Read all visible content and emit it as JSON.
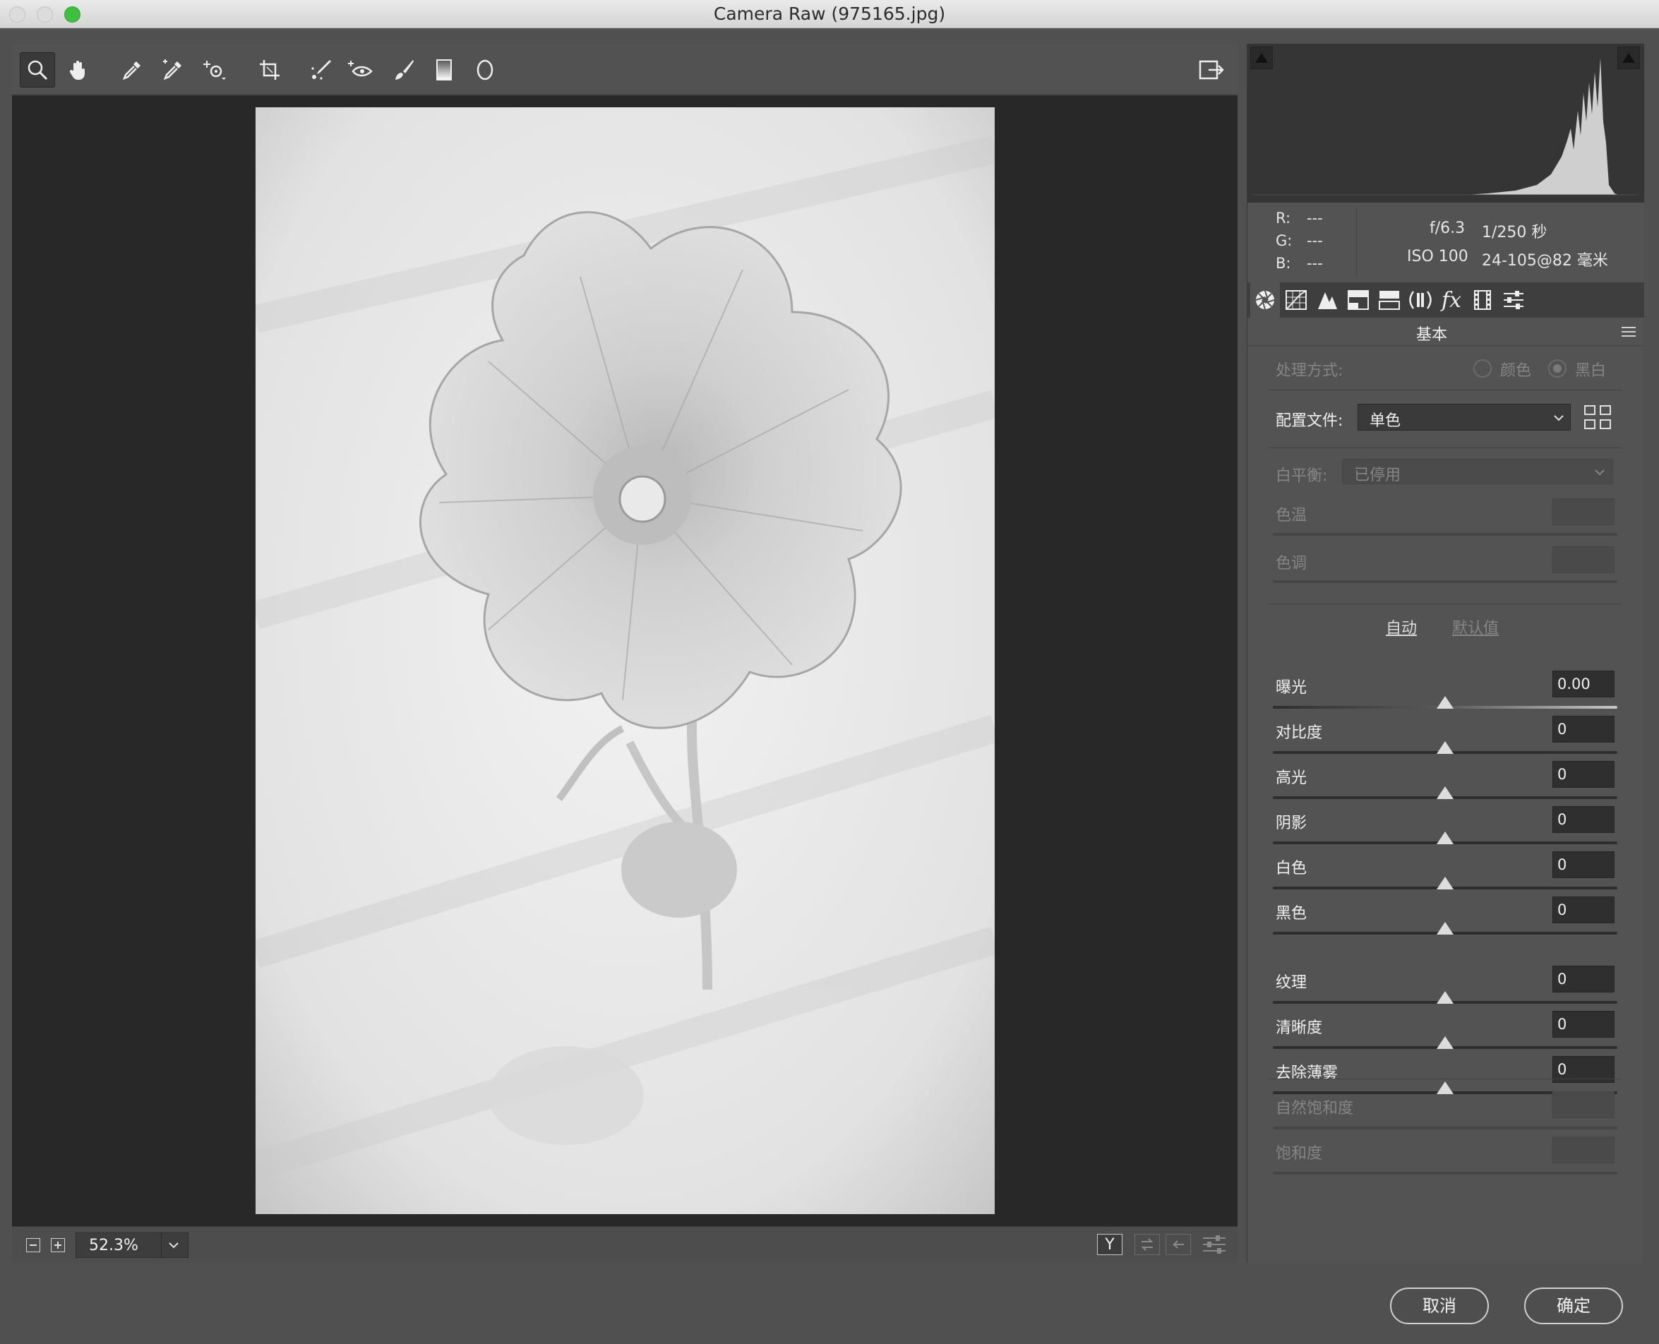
{
  "window": {
    "title": "Camera Raw (975165.jpg)"
  },
  "traffic_lights": {
    "close": "#e0e0e0",
    "minimize": "#e0e0e0",
    "zoom": "#3fbf3f"
  },
  "toolbar": {
    "tools": [
      "zoom-tool",
      "hand-tool",
      "white-balance-tool",
      "color-sampler-tool",
      "targeted-adjustment-tool",
      "crop-tool",
      "straighten-tool",
      "spot-removal-tool",
      "red-eye-tool",
      "adjustment-brush-tool",
      "graduated-filter-tool",
      "radial-filter-tool"
    ],
    "open_preferences": "preferences-icon"
  },
  "readout": {
    "r_label": "R:",
    "g_label": "G:",
    "b_label": "B:",
    "r": "---",
    "g": "---",
    "b": "---",
    "aperture": "f/6.3",
    "shutter": "1/250 秒",
    "iso": "ISO 100",
    "lens": "24-105@82 毫米"
  },
  "panel": {
    "title": "基本",
    "treatment_label": "处理方式:",
    "treatment_color": "颜色",
    "treatment_bw": "黑白",
    "profile_label": "配置文件:",
    "profile_value": "单色",
    "wb_label": "白平衡:",
    "wb_value": "已停用",
    "temp_label": "色温",
    "tint_label": "色调",
    "auto_label": "自动",
    "default_label": "默认值",
    "sliders": [
      {
        "label": "曝光",
        "value": "0.00"
      },
      {
        "label": "对比度",
        "value": "0"
      },
      {
        "label": "高光",
        "value": "0"
      },
      {
        "label": "阴影",
        "value": "0"
      },
      {
        "label": "白色",
        "value": "0"
      },
      {
        "label": "黑色",
        "value": "0"
      },
      {
        "label": "纹理",
        "value": "0"
      },
      {
        "label": "清晰度",
        "value": "0"
      },
      {
        "label": "去除薄雾",
        "value": "0"
      }
    ],
    "vibrance_label": "自然饱和度",
    "saturation_label": "饱和度"
  },
  "bottom": {
    "zoom": "52.3%",
    "compare": "Y"
  },
  "buttons": {
    "cancel": "取消",
    "ok": "确定"
  }
}
